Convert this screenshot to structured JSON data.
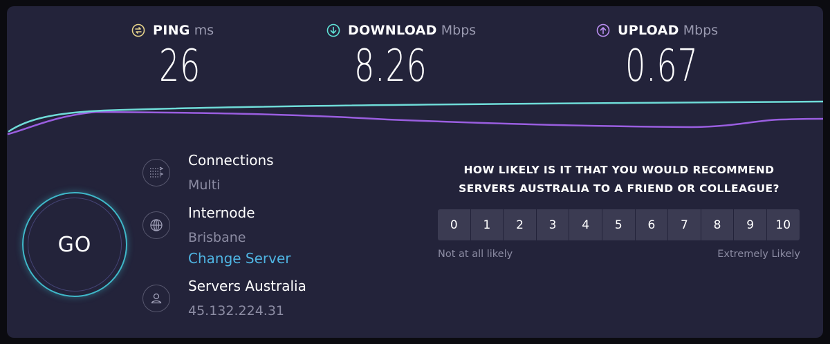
{
  "metrics": {
    "ping": {
      "label": "PING",
      "unit": "ms",
      "value": "26",
      "icon": "ping-icon",
      "color": "#e5d28a"
    },
    "download": {
      "label": "DOWNLOAD",
      "unit": "Mbps",
      "value": "8.26",
      "icon": "download-icon",
      "color": "#5fe3d6"
    },
    "upload": {
      "label": "UPLOAD",
      "unit": "Mbps",
      "value": "0.67",
      "icon": "upload-icon",
      "color": "#b98ef0"
    }
  },
  "graph": {
    "download_color": "#6fdcd8",
    "upload_color": "#9a5ee0"
  },
  "go_button": {
    "label": "GO",
    "ring_color": "#3fb8c9"
  },
  "info": {
    "connections": {
      "title": "Connections",
      "value": "Multi",
      "icon": "connections-icon"
    },
    "server": {
      "title": "Internode",
      "value": "Brisbane",
      "link": "Change Server",
      "icon": "globe-icon"
    },
    "host": {
      "title": "Servers Australia",
      "value": "45.132.224.31",
      "icon": "user-icon"
    }
  },
  "survey": {
    "question": "HOW LIKELY IS IT THAT YOU WOULD RECOMMEND SERVERS AUSTRALIA TO A FRIEND OR COLLEAGUE?",
    "scale": [
      "0",
      "1",
      "2",
      "3",
      "4",
      "5",
      "6",
      "7",
      "8",
      "9",
      "10"
    ],
    "low_label": "Not at all likely",
    "high_label": "Extremely Likely"
  }
}
